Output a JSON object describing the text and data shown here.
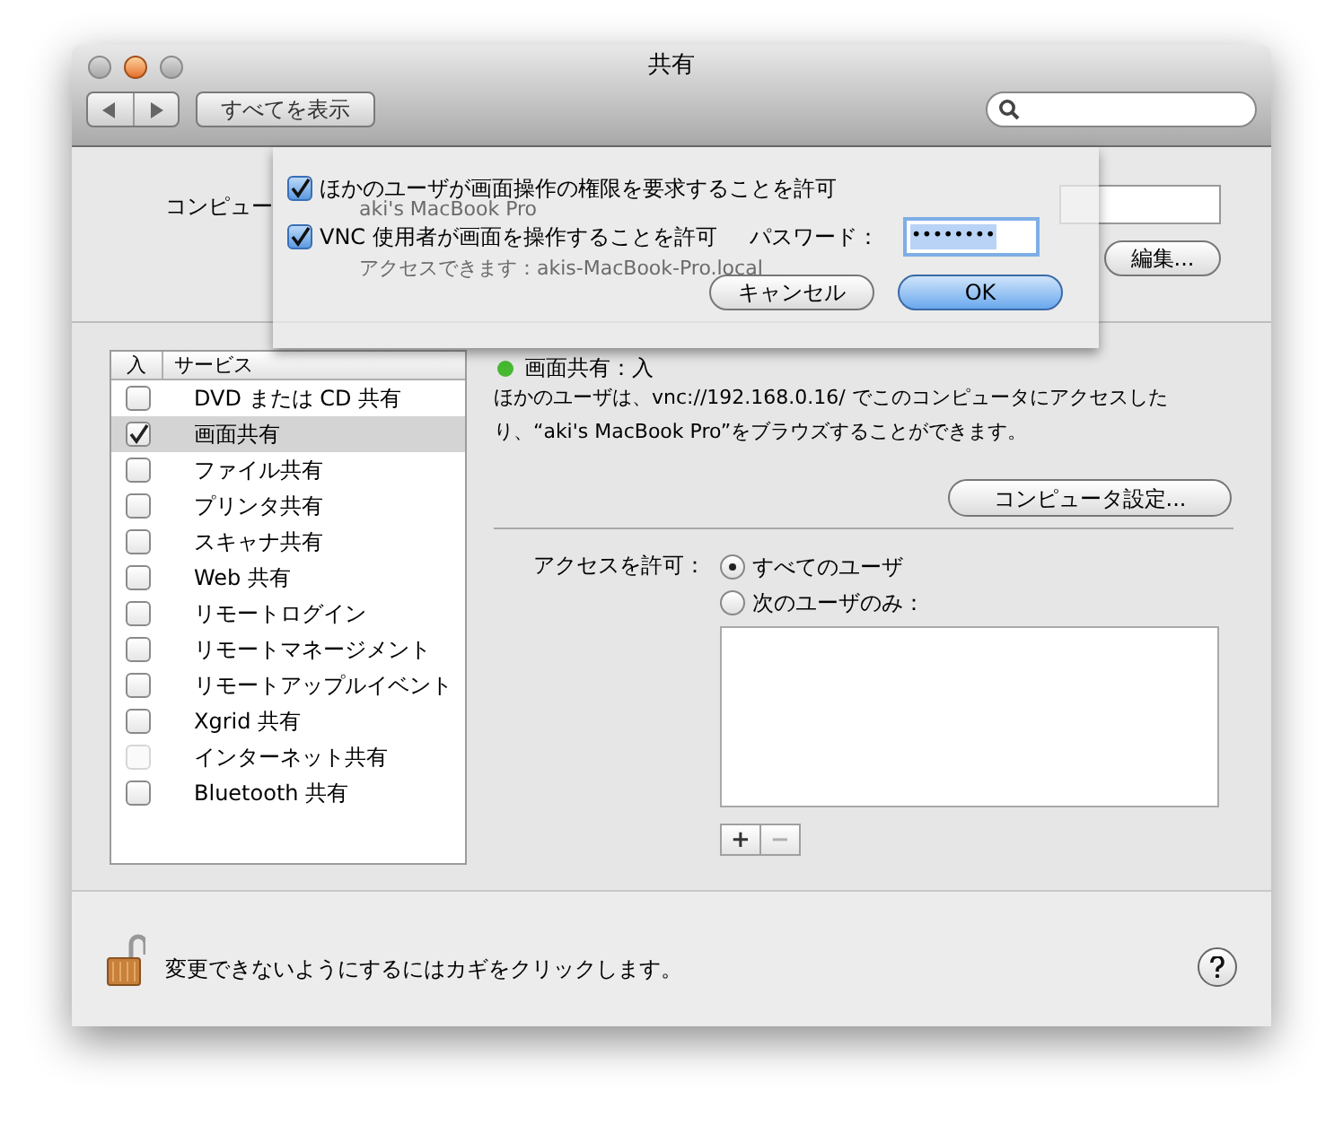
{
  "window": {
    "title": "共有"
  },
  "toolbar": {
    "show_all_button": "すべてを表示"
  },
  "computer_name": {
    "label": "コンピュー",
    "edit_button": "編集..."
  },
  "behind_sheet": {
    "computer_name_value": "aki's MacBook Pro",
    "address_note": "アクセスできます：akis-MacBook-Pro.local"
  },
  "sheet": {
    "options": [
      {
        "label": "ほかのユーザが画面操作の権限を要求することを許可",
        "checked": true
      },
      {
        "label": "VNC 使用者が画面を操作することを許可",
        "checked": true
      }
    ],
    "password": {
      "label": "パスワード：",
      "value": "••••••••"
    },
    "buttons": [
      {
        "label": "キャンセル",
        "kind": "secondary"
      },
      {
        "label": "OK",
        "kind": "default"
      }
    ]
  },
  "services": {
    "columns": [
      "入",
      "サービス"
    ],
    "rows": [
      {
        "name": "DVD または CD 共有",
        "checked": false,
        "selected": false,
        "disabled": false
      },
      {
        "name": "画面共有",
        "checked": true,
        "selected": true,
        "disabled": false
      },
      {
        "name": "ファイル共有",
        "checked": false,
        "selected": false,
        "disabled": false
      },
      {
        "name": "プリンタ共有",
        "checked": false,
        "selected": false,
        "disabled": false
      },
      {
        "name": "スキャナ共有",
        "checked": false,
        "selected": false,
        "disabled": false
      },
      {
        "name": "Web 共有",
        "checked": false,
        "selected": false,
        "disabled": false
      },
      {
        "name": "リモートログイン",
        "checked": false,
        "selected": false,
        "disabled": false
      },
      {
        "name": "リモートマネージメント",
        "checked": false,
        "selected": false,
        "disabled": false
      },
      {
        "name": "リモートアップルイベント",
        "checked": false,
        "selected": false,
        "disabled": false
      },
      {
        "name": "Xgrid 共有",
        "checked": false,
        "selected": false,
        "disabled": false
      },
      {
        "name": "インターネット共有",
        "checked": false,
        "selected": false,
        "disabled": true
      },
      {
        "name": "Bluetooth 共有",
        "checked": false,
        "selected": false,
        "disabled": false
      }
    ]
  },
  "status": {
    "label": "画面共有：入",
    "on": true
  },
  "description": "ほかのユーザは、vnc://192.168.0.16/ でこのコンピュータにアクセスしたり、“aki's MacBook Pro”をブラウズすることができます。",
  "computer_settings_button": "コンピュータ設定...",
  "access": {
    "label": "アクセスを許可：",
    "options": [
      {
        "label": "すべてのユーザ",
        "selected": true
      },
      {
        "label": "次のユーザのみ：",
        "selected": false
      }
    ]
  },
  "user_list_buttons": [
    {
      "label": "+",
      "disabled": false
    },
    {
      "label": "−",
      "disabled": true
    }
  ],
  "lock": {
    "locked": false,
    "text": "変更できないようにするにはカギをクリックします。"
  }
}
